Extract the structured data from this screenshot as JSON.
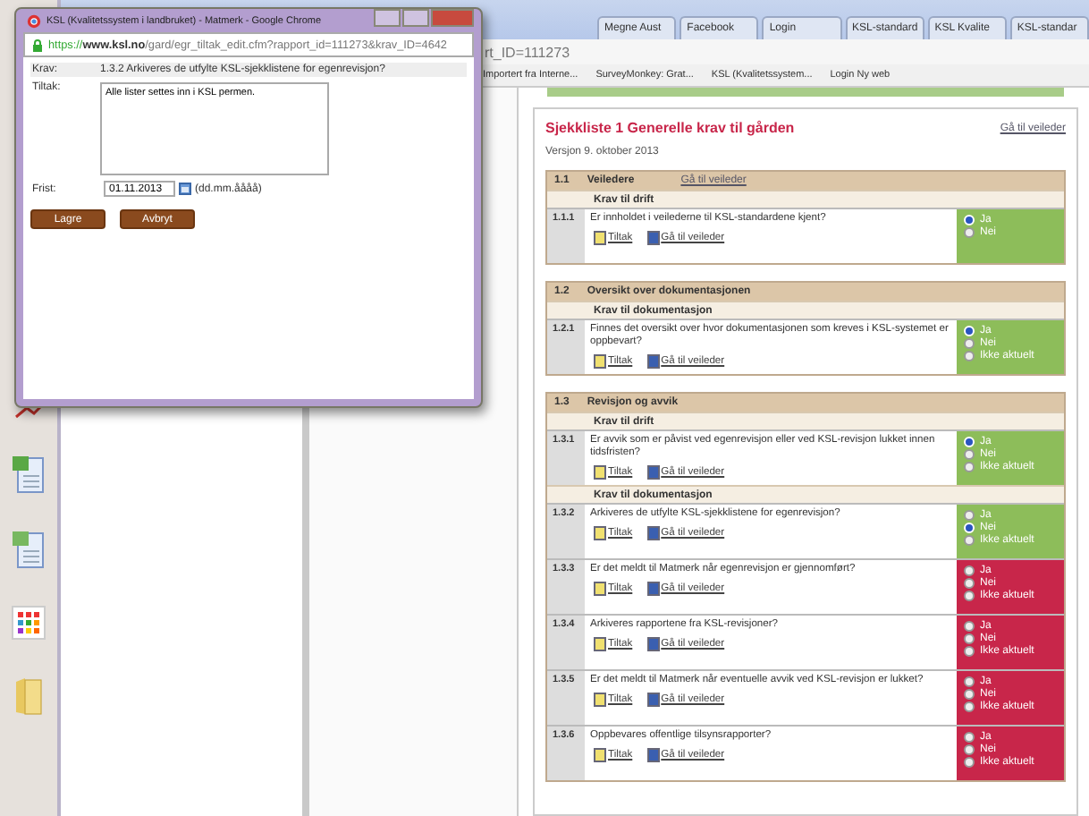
{
  "browser": {
    "tabs": [
      {
        "label": "Megne Aust"
      },
      {
        "label": "Facebook"
      },
      {
        "label": "Login"
      },
      {
        "label": "KSL-standard"
      },
      {
        "label": "KSL Kvalite"
      },
      {
        "label": "KSL-standar"
      }
    ],
    "address": "rt_ID=111273",
    "bookmarks": [
      "Importert fra Interne...",
      "SurveyMonkey: Grat...",
      "KSL (Kvalitetssystem...",
      "Login Ny web"
    ]
  },
  "checklist": {
    "title": "Sjekkliste 1 Generelle krav til gården",
    "guide_link": "Gå til veileder",
    "version": "Versjon 9. oktober 2013",
    "sections": [
      {
        "number": "1.1",
        "title": "Veiledere",
        "link": "Gå til veileder",
        "groups": [
          {
            "heading": "Krav til drift",
            "items": [
              {
                "number": "1.1.1",
                "question": "Er innholdet i veilederne til KSL-standardene kjent?",
                "actions": [
                  "Tiltak",
                  "Gå til veileder"
                ],
                "color": "#8dbd5a",
                "options": [
                  {
                    "label": "Ja",
                    "selected": true
                  },
                  {
                    "label": "Nei",
                    "selected": false
                  }
                ]
              }
            ]
          }
        ]
      },
      {
        "number": "1.2",
        "title": "Oversikt over dokumentasjonen",
        "groups": [
          {
            "heading": "Krav til dokumentasjon",
            "items": [
              {
                "number": "1.2.1",
                "question": "Finnes det oversikt over hvor dokumentasjonen som kreves i KSL-systemet er oppbevart?",
                "actions": [
                  "Tiltak",
                  "Gå til veileder"
                ],
                "color": "#8dbd5a",
                "options": [
                  {
                    "label": "Ja",
                    "selected": true
                  },
                  {
                    "label": "Nei",
                    "selected": false
                  },
                  {
                    "label": "Ikke aktuelt",
                    "selected": false
                  }
                ]
              }
            ]
          }
        ]
      },
      {
        "number": "1.3",
        "title": "Revisjon og avvik",
        "groups": [
          {
            "heading": "Krav til drift",
            "items": [
              {
                "number": "1.3.1",
                "question": "Er avvik som er påvist ved egenrevisjon eller ved KSL-revisjon lukket innen tidsfristen?",
                "actions": [
                  "Tiltak",
                  "Gå til veileder"
                ],
                "color": "#8dbd5a",
                "options": [
                  {
                    "label": "Ja",
                    "selected": true
                  },
                  {
                    "label": "Nei",
                    "selected": false
                  },
                  {
                    "label": "Ikke aktuelt",
                    "selected": false
                  }
                ]
              }
            ]
          },
          {
            "heading": "Krav til dokumentasjon",
            "items": [
              {
                "number": "1.3.2",
                "question": "Arkiveres de utfylte KSL-sjekklistene for egenrevisjon?",
                "actions": [
                  "Tiltak",
                  "Gå til veileder"
                ],
                "color": "#8dbd5a",
                "options": [
                  {
                    "label": "Ja",
                    "selected": false
                  },
                  {
                    "label": "Nei",
                    "selected": true
                  },
                  {
                    "label": "Ikke aktuelt",
                    "selected": false
                  }
                ]
              },
              {
                "number": "1.3.3",
                "question": "Er det meldt til Matmerk når egenrevisjon er gjennomført?",
                "actions": [
                  "Tiltak",
                  "Gå til veileder"
                ],
                "color": "#c8264a",
                "options": [
                  {
                    "label": "Ja",
                    "selected": false
                  },
                  {
                    "label": "Nei",
                    "selected": false
                  },
                  {
                    "label": "Ikke aktuelt",
                    "selected": false
                  }
                ]
              },
              {
                "number": "1.3.4",
                "question": "Arkiveres rapportene fra KSL-revisjoner?",
                "actions": [
                  "Tiltak",
                  "Gå til veileder"
                ],
                "color": "#c8264a",
                "options": [
                  {
                    "label": "Ja",
                    "selected": false
                  },
                  {
                    "label": "Nei",
                    "selected": false
                  },
                  {
                    "label": "Ikke aktuelt",
                    "selected": false
                  }
                ]
              },
              {
                "number": "1.3.5",
                "question": "Er det meldt til Matmerk når eventuelle avvik ved KSL-revisjon er lukket?",
                "actions": [
                  "Tiltak",
                  "Gå til veileder"
                ],
                "color": "#c8264a",
                "options": [
                  {
                    "label": "Ja",
                    "selected": false
                  },
                  {
                    "label": "Nei",
                    "selected": false
                  },
                  {
                    "label": "Ikke aktuelt",
                    "selected": false
                  }
                ]
              },
              {
                "number": "1.3.6",
                "question": "Oppbevares offentlige tilsynsrapporter?",
                "actions": [
                  "Tiltak",
                  "Gå til veileder"
                ],
                "color": "#c8264a",
                "options": [
                  {
                    "label": "Ja",
                    "selected": false
                  },
                  {
                    "label": "Nei",
                    "selected": false
                  },
                  {
                    "label": "Ikke aktuelt",
                    "selected": false
                  }
                ]
              }
            ]
          }
        ]
      }
    ]
  },
  "popup": {
    "title": "KSL (Kvalitetssystem i landbruket) - Matmerk - Google Chrome",
    "url_scheme": "https://",
    "url_host": "www.ksl.no",
    "url_path": "/gard/egr_tiltak_edit.cfm?rapport_id=111273&krav_ID=4642",
    "fields": [
      {
        "kind": "text",
        "label": "Krav:",
        "value": "1.3.2   Arkiveres de utfylte KSL-sjekklistene for egenrevisjon?"
      },
      {
        "kind": "textarea",
        "label": "Tiltak:",
        "value": "Alle lister settes inn i KSL permen."
      },
      {
        "kind": "date",
        "label": "Frist:",
        "value": "01.11.2013",
        "hint": "(dd.mm.åååå)"
      }
    ],
    "buttons": [
      "Lagre",
      "Avbryt"
    ]
  }
}
